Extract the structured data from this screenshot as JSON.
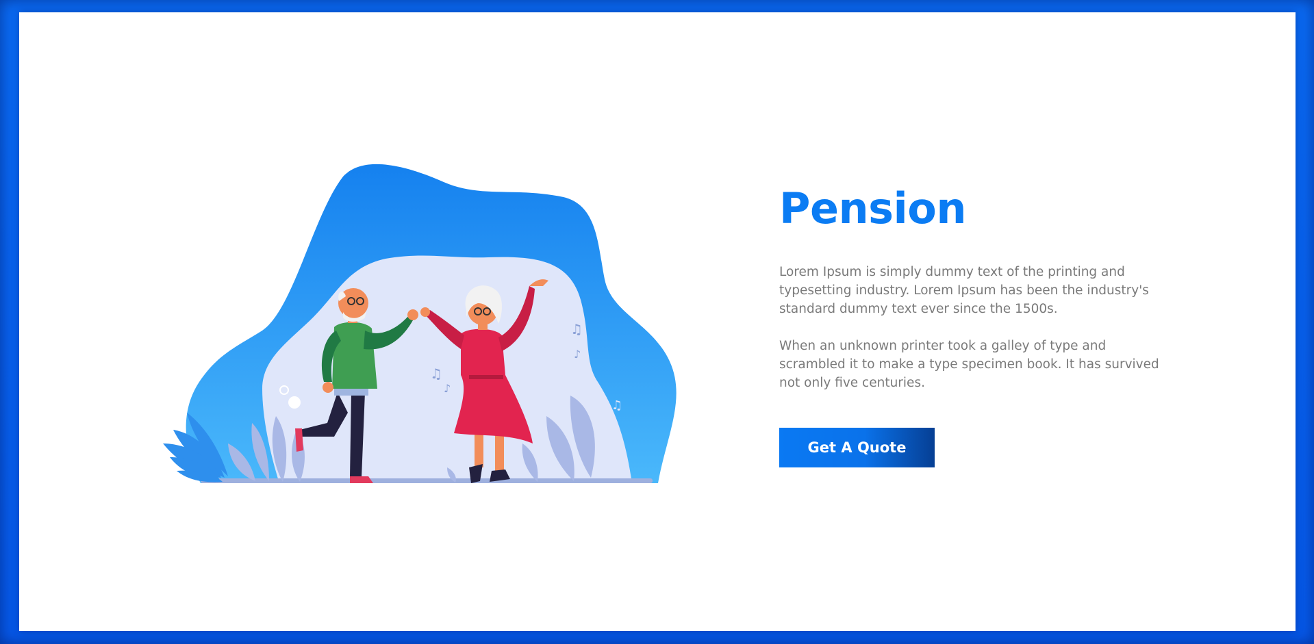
{
  "hero": {
    "title": "Pension",
    "paragraph_1": "Lorem Ipsum is simply dummy text of the printing and typesetting industry. Lorem Ipsum has been the industry's standard dummy text ever since the 1500s.",
    "paragraph_2": "When an unknown printer took a galley of type and scrambled it to make a type specimen book. It has survived not only five centuries.",
    "cta_label": "Get A Quote"
  },
  "illustration": {
    "subject": "elderly couple dancing",
    "icons": [
      "music-note-icon",
      "leaf-icon"
    ]
  },
  "colors": {
    "frame": "#0a63f0",
    "accent": "#0b7cf3",
    "blob": "#1e8ef3",
    "inner_blob": "#dfe6fa",
    "text": "#7a7a7a",
    "button_dark": "#063f94"
  }
}
